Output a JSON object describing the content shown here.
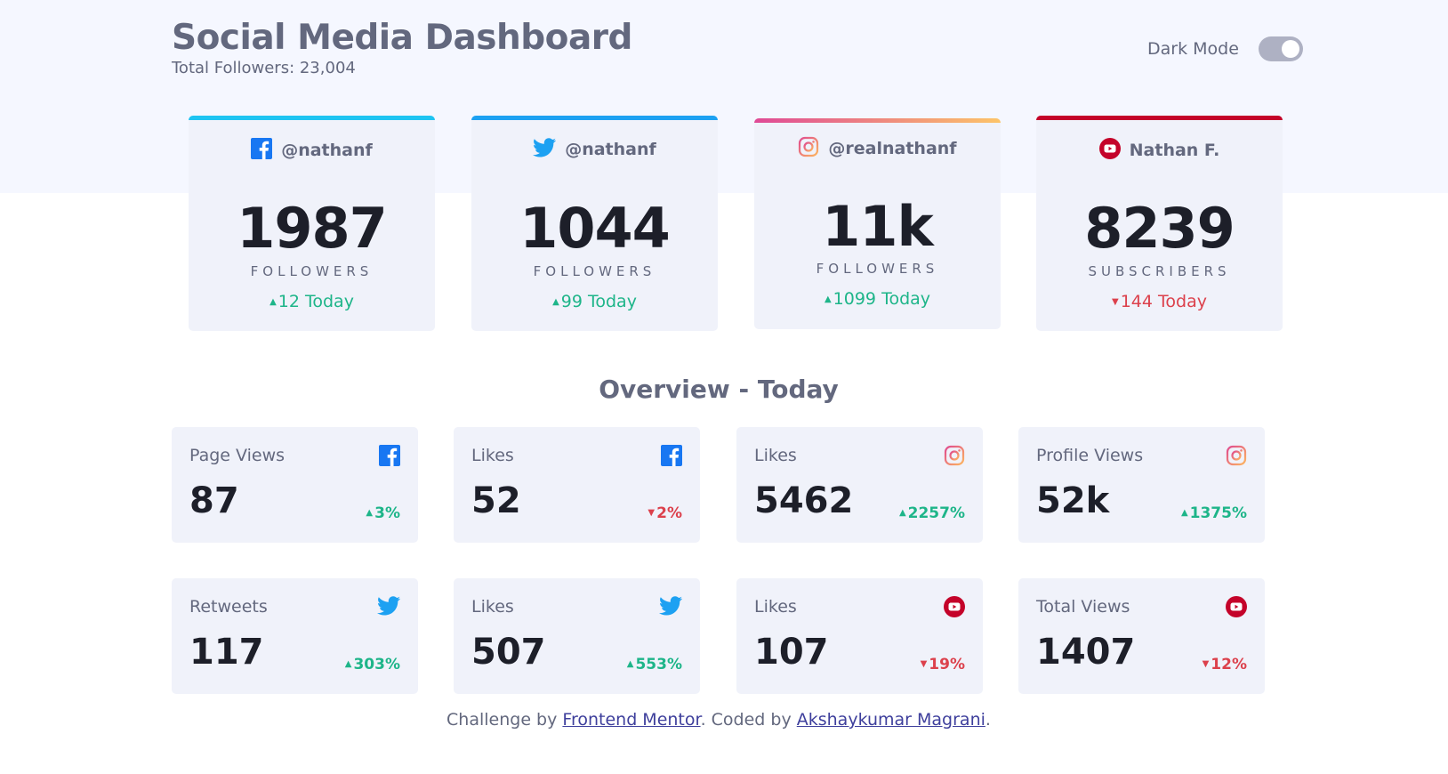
{
  "header": {
    "title": "Social Media Dashboard",
    "total_followers": "Total Followers: 23,004",
    "dark_mode_label": "Dark Mode"
  },
  "colors": {
    "facebook": "#1877f2",
    "twitter": "#1da1f2",
    "instagram_start": "#df4996",
    "instagram_end": "#fdc468",
    "youtube": "#c4032a",
    "up": "#1eb589",
    "down": "#dc414c"
  },
  "followers": [
    {
      "platform": "facebook",
      "icon": "facebook-icon",
      "handle": "@nathanf",
      "count": "1987",
      "unit": "FOLLOWERS",
      "delta": "12 Today",
      "trend": "up"
    },
    {
      "platform": "twitter",
      "icon": "twitter-icon",
      "handle": "@nathanf",
      "count": "1044",
      "unit": "FOLLOWERS",
      "delta": "99 Today",
      "trend": "up"
    },
    {
      "platform": "instagram",
      "icon": "instagram-icon",
      "handle": "@realnathanf",
      "count": "11k",
      "unit": "FOLLOWERS",
      "delta": "1099 Today",
      "trend": "up"
    },
    {
      "platform": "youtube",
      "icon": "youtube-icon",
      "handle": "Nathan F.",
      "count": "8239",
      "unit": "SUBSCRIBERS",
      "delta": "144 Today",
      "trend": "down"
    }
  ],
  "overview": {
    "title": "Overview - Today",
    "cards": [
      {
        "label": "Page Views",
        "icon": "facebook-icon",
        "value": "87",
        "pct": "3%",
        "trend": "up"
      },
      {
        "label": "Likes",
        "icon": "facebook-icon",
        "value": "52",
        "pct": "2%",
        "trend": "down"
      },
      {
        "label": "Likes",
        "icon": "instagram-icon",
        "value": "5462",
        "pct": "2257%",
        "trend": "up"
      },
      {
        "label": "Profile Views",
        "icon": "instagram-icon",
        "value": "52k",
        "pct": "1375%",
        "trend": "up"
      },
      {
        "label": "Retweets",
        "icon": "twitter-icon",
        "value": "117",
        "pct": "303%",
        "trend": "up"
      },
      {
        "label": "Likes",
        "icon": "twitter-icon",
        "value": "507",
        "pct": "553%",
        "trend": "up"
      },
      {
        "label": "Likes",
        "icon": "youtube-icon",
        "value": "107",
        "pct": "19%",
        "trend": "down"
      },
      {
        "label": "Total Views",
        "icon": "youtube-icon",
        "value": "1407",
        "pct": "12%",
        "trend": "down"
      }
    ]
  },
  "footer": {
    "prefix": "Challenge by ",
    "link1": "Frontend Mentor",
    "middle": ". Coded by ",
    "link2": "Akshaykumar Magrani",
    "suffix": "."
  }
}
